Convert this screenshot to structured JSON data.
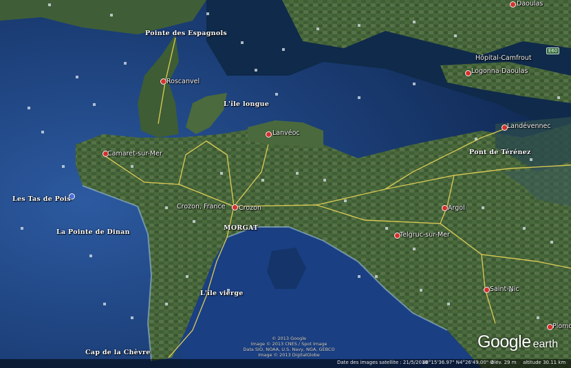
{
  "labels": {
    "pointe_espagnols": "Pointe des Espagnols",
    "roscanvel": "Roscanvel",
    "ile_longue": "L'île longue",
    "lanveoc": "Lanvéoc",
    "camaret": "Camaret-sur-Mer",
    "tas_de_pois": "Les Tas de Pois",
    "pointe_dinan": "La Pointe de Dinan",
    "crozon_france": "Crozon, France",
    "crozon": "Crozon",
    "morgat": "MORGAT",
    "ile_vierge": "L'île vierge",
    "cap_chevre": "Cap de la Chèvre",
    "argol": "Argol",
    "telgruc": "Telgruc-sur-Mer",
    "saint_nic": "Saint-Nic",
    "plomo": "Plomo",
    "pont_terenez": "Pont de Térénez",
    "landevennec": "Landévennec",
    "hopital_camfrout": "Hôpital-Camfrout",
    "logonna": "Logonna-Daoulas",
    "daoulas": "Daoulas",
    "road_e60": "E60"
  },
  "credits": {
    "line1": "© 2013 Google",
    "line2": "Image © 2013 CNES / Spot Image",
    "line3": "Data SIO, NOAA, U.S. Navy, NGA, GEBCO",
    "line4": "Image © 2013 DigitalGlobe"
  },
  "status": {
    "imagery_date": "Date des images satellite : 21/5/2010",
    "latitude": "48°15'36.97\" N",
    "longitude": "4°26'49.00\" O",
    "elevation": "élév.  29 m",
    "eye_altitude": "altitude  30.11 km"
  },
  "logo": {
    "google": "Google",
    "earth": "earth"
  },
  "colors": {
    "deep_sea": "#1c3f78",
    "bay_water": "#0f2a4a",
    "land": "#3c5a34",
    "road": "#e6d257",
    "pin": "#d6302b"
  }
}
